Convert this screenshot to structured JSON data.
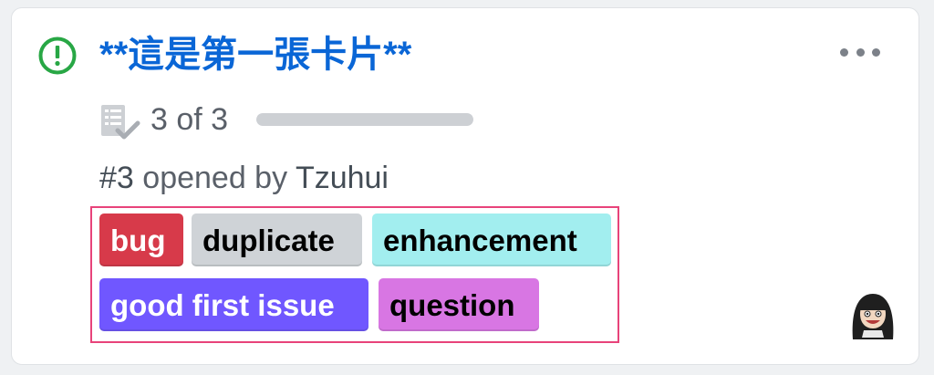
{
  "card": {
    "title": "**這是第一張卡片**",
    "status": "open",
    "task_progress": {
      "text": "3 of 3",
      "completed": 3,
      "total": 3
    },
    "meta": {
      "number": "#3",
      "opened_by_text": "opened by",
      "author": "Tzuhui"
    },
    "labels": [
      {
        "name": "bug",
        "color": "#d73a4a",
        "text_color": "#ffffff"
      },
      {
        "name": "duplicate",
        "color": "#cfd3d7",
        "text_color": "#000000"
      },
      {
        "name": "enhancement",
        "color": "#a2eeef",
        "text_color": "#000000"
      },
      {
        "name": "good first issue",
        "color": "#7057ff",
        "text_color": "#ffffff"
      },
      {
        "name": "question",
        "color": "#d876e3",
        "text_color": "#000000"
      }
    ],
    "icons": {
      "status": "issue-opened-icon",
      "tasklist": "tasklist-icon",
      "more": "kebab-horizontal-icon",
      "avatar": "avatar"
    },
    "colors": {
      "title": "#0a66d6",
      "status_icon": "#28a745",
      "highlight_box": "#e8437a"
    }
  }
}
